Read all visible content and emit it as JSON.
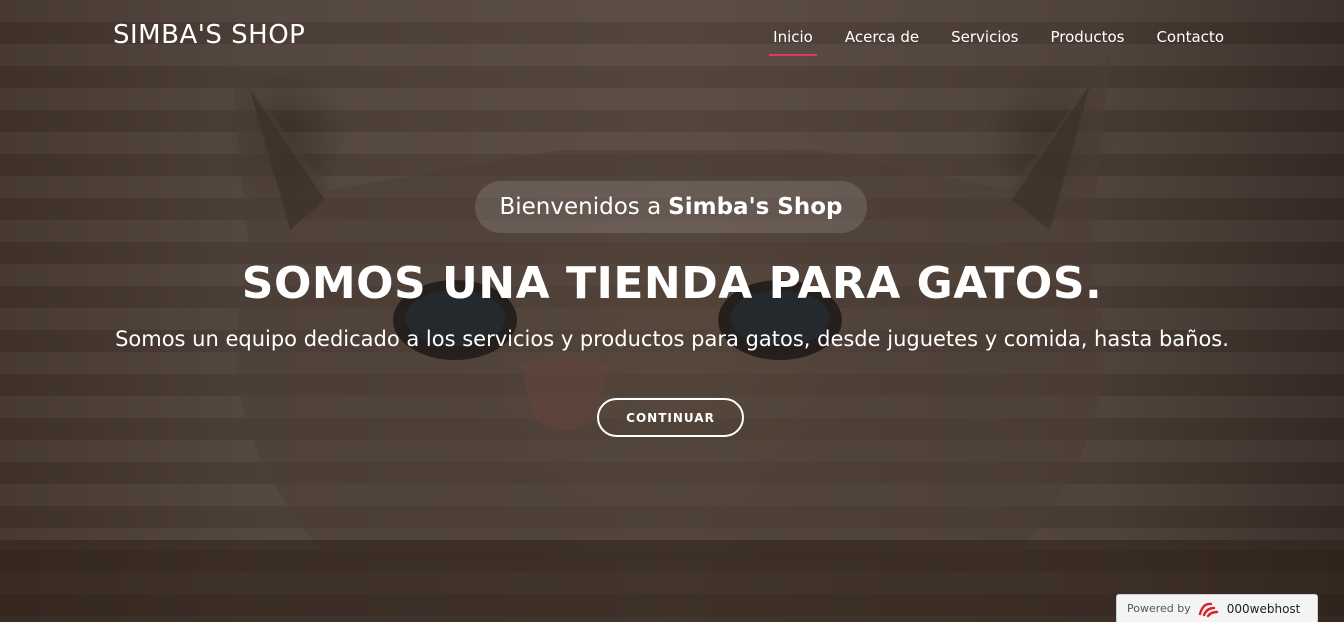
{
  "header": {
    "logo": "SIMBA'S SHOP",
    "nav": [
      "Inicio",
      "Acerca de",
      "Servicios",
      "Productos",
      "Contacto"
    ],
    "active_nav": "Inicio",
    "accent_color": "#e03a5a"
  },
  "hero": {
    "welcome_prefix": "Bienvenidos a",
    "welcome_brand": "Simba's Shop",
    "headline": "SOMOS UNA TIENDA PARA GATOS.",
    "subheadline": "Somos un equipo dedicado a los servicios y productos para gatos, desde juguetes y comida, hasta baños.",
    "cta_label": "CONTINUAR",
    "background_image": "cat-photo"
  },
  "badge": {
    "powered_by": "Powered by",
    "brand": "000webhost",
    "icon": "000webhost-logo-icon"
  }
}
